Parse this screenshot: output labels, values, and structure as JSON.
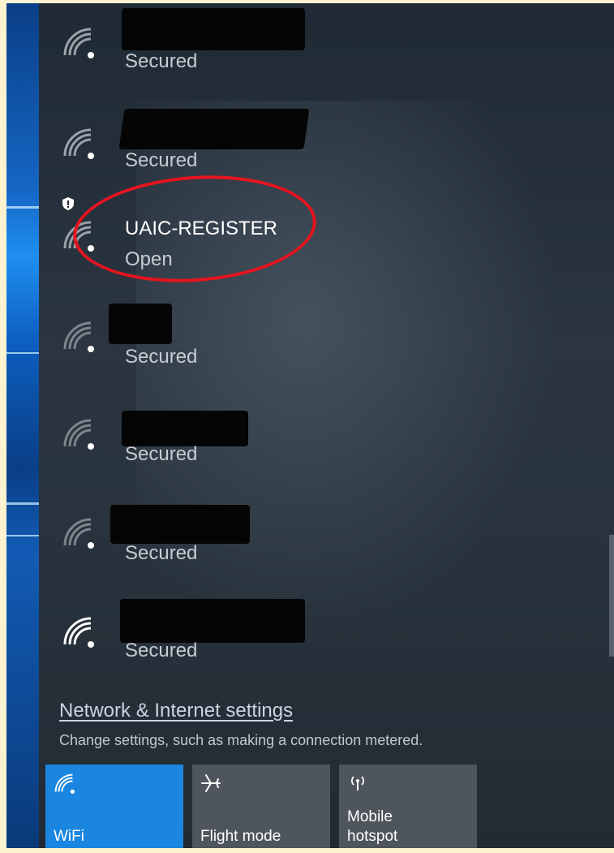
{
  "networks": [
    {
      "status": "Secured"
    },
    {
      "status": "Secured"
    },
    {
      "ssid": "UAIC-REGISTER",
      "status": "Open"
    },
    {
      "status": "Secured"
    },
    {
      "status": "Secured"
    },
    {
      "status": "Secured"
    },
    {
      "status": "Secured"
    }
  ],
  "settings": {
    "link": "Network & Internet settings",
    "description": "Change settings, such as making a connection metered."
  },
  "quick_actions": [
    {
      "label": "WiFi",
      "icon": "wifi-icon",
      "active": true
    },
    {
      "label": "Flight mode",
      "icon": "airplane-icon",
      "active": false
    },
    {
      "label": "Mobile\nhotspot",
      "icon": "hotspot-icon",
      "active": false
    }
  ],
  "colors": {
    "accent": "#1a86e0",
    "highlight_ring": "#e6141e",
    "panel": "#27323c",
    "tile": "#4e555c"
  }
}
